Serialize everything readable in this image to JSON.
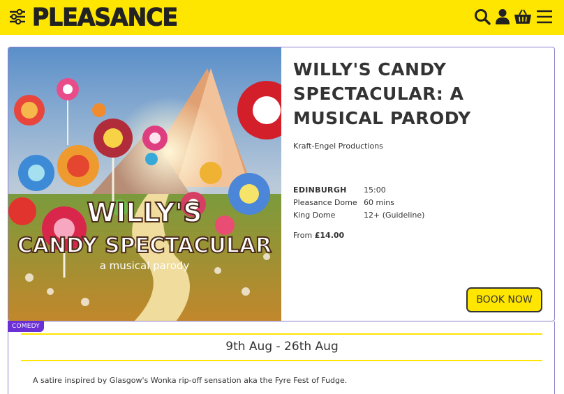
{
  "header": {
    "logo_text": "PLEASANCE",
    "background_color": "#ffe600",
    "icons": [
      "filter-icon",
      "search-icon",
      "account-icon",
      "basket-icon",
      "menu-icon"
    ]
  },
  "show": {
    "title": "WILLY'S CANDY SPECTACULAR: A MUSICAL PARODY",
    "producer": "Kraft-Engel Productions",
    "city": "EDINBURGH",
    "time": "15:00",
    "venue": "Pleasance Dome",
    "duration": "60 mins",
    "room": "King Dome",
    "age": "12+ (Guideline)",
    "price_prefix": "From ",
    "price": "£14.00",
    "book_label": "BOOK NOW",
    "genre": "COMEDY",
    "dates": "9th Aug - 26th Aug",
    "description": "A satire inspired by Glasgow's Wonka rip-off sensation aka the Fyre Fest of Fudge."
  },
  "poster": {
    "title_line1": "WILLY'S",
    "title_line2": "CANDY SPECTACULAR",
    "tagline": "a musical parody"
  },
  "colors": {
    "accent_yellow": "#ffe600",
    "card_border": "#8c7fcf",
    "badge_purple": "#6b2fd6",
    "text_dark": "#333333"
  }
}
